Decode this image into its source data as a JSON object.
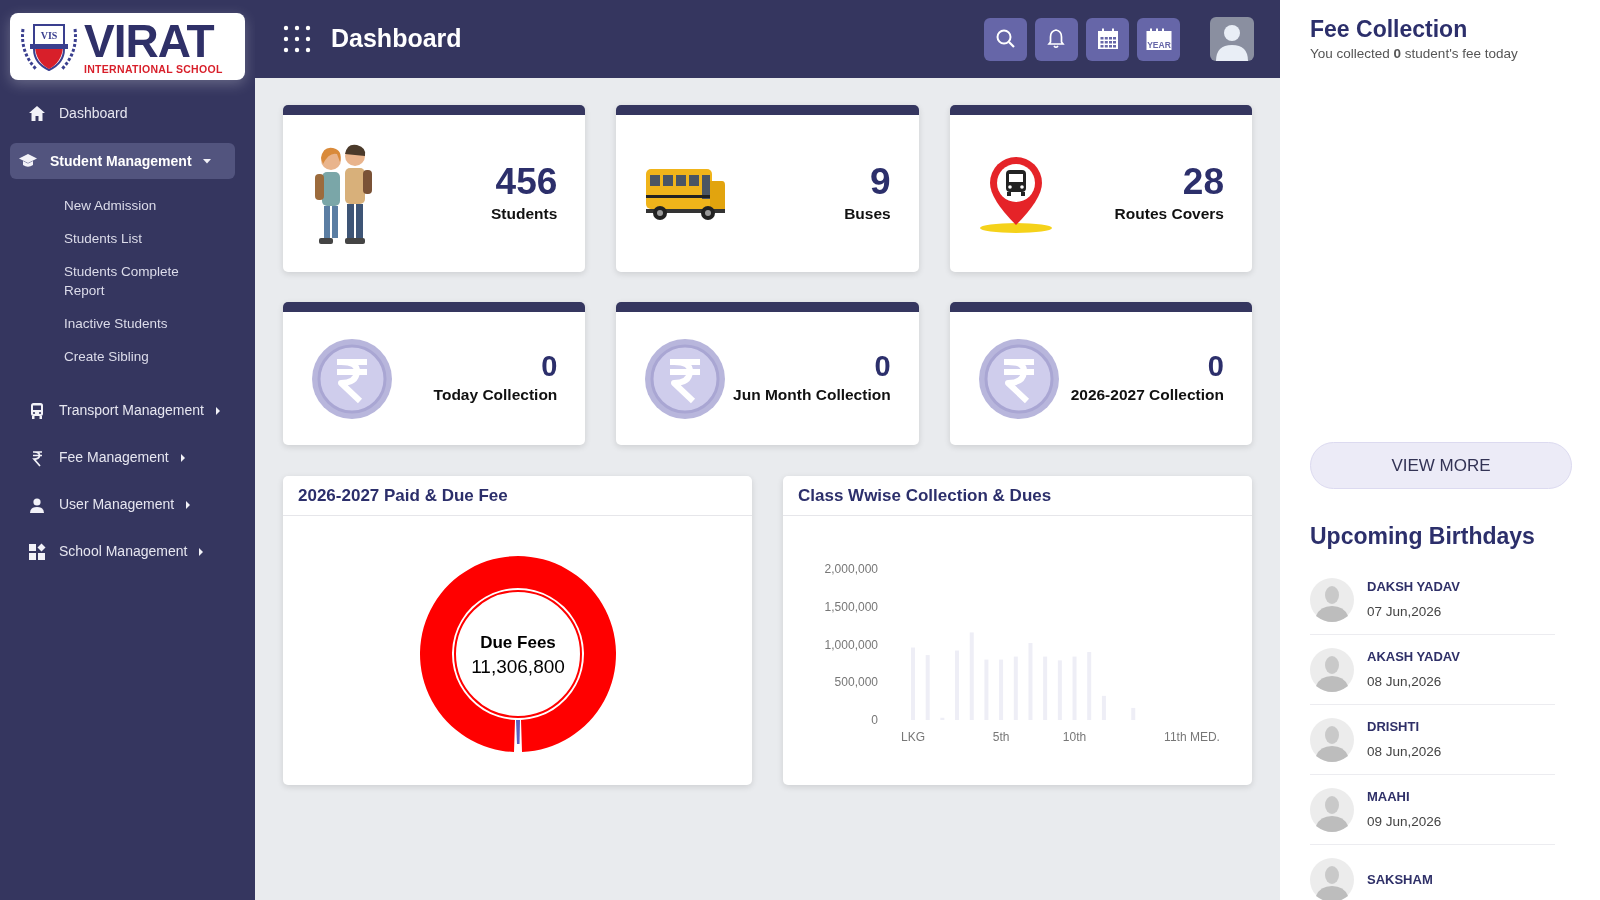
{
  "logo": {
    "badge": "VIS",
    "title": "VIRAT",
    "subtitle": "INTERNATIONAL SCHOOL"
  },
  "sidebar": {
    "items": [
      {
        "label": "Dashboard",
        "kind": "link",
        "selected": false
      },
      {
        "label": "Student Management",
        "kind": "group",
        "selected": true,
        "expanded": true,
        "children": [
          {
            "label": "New Admission",
            "selected": false
          },
          {
            "label": "Students List",
            "selected": false
          },
          {
            "label": "Students Complete Report",
            "selected": false
          },
          {
            "label": "Inactive Students",
            "selected": false
          },
          {
            "label": "Create Sibling",
            "selected": false
          }
        ]
      },
      {
        "label": "Transport Management",
        "kind": "group",
        "selected": false,
        "expanded": false
      },
      {
        "label": "Fee Management",
        "kind": "group",
        "selected": false,
        "expanded": false
      },
      {
        "label": "User Management",
        "kind": "group",
        "selected": false,
        "expanded": false
      },
      {
        "label": "School Management",
        "kind": "group",
        "selected": false,
        "expanded": false
      }
    ]
  },
  "header": {
    "title": "Dashboard",
    "year_button_label": "YEAR"
  },
  "stats": [
    {
      "value": "456",
      "label": "Students"
    },
    {
      "value": "9",
      "label": "Buses"
    },
    {
      "value": "28",
      "label": "Routes Covers"
    },
    {
      "value": "0",
      "label": "Today Collection"
    },
    {
      "value": "0",
      "label": "Jun Month Collection"
    },
    {
      "value": "0",
      "label": "2026-2027 Collection"
    }
  ],
  "fee_chart": {
    "title": "2026-2027 Paid & Due Fee",
    "center_label": "Due Fees",
    "center_value": "11,306,800"
  },
  "class_chart": {
    "title": "Class Wwise Collection & Dues",
    "chart_data": {
      "type": "bar",
      "categories": [
        "LKG",
        null,
        null,
        null,
        null,
        null,
        "5th",
        null,
        null,
        null,
        null,
        "10th",
        null,
        null,
        null,
        null,
        null,
        null,
        null,
        "11th MED."
      ],
      "series": [
        {
          "color": "#eeeef6",
          "values": [
            960000,
            860000,
            30000,
            920000,
            1160000,
            800000,
            800000,
            840000,
            1020000,
            840000,
            790000,
            840000,
            900000,
            320000,
            0,
            160000,
            0,
            0,
            0,
            0
          ]
        }
      ],
      "ylim": [
        0,
        2000000
      ],
      "yticks": [
        {
          "value": 0,
          "label": "0"
        },
        {
          "value": 500000,
          "label": "500,000"
        },
        {
          "value": 1000000,
          "label": "1,000,000"
        },
        {
          "value": 1500000,
          "label": "1,500,000"
        },
        {
          "value": 2000000,
          "label": "2,000,000"
        }
      ]
    }
  },
  "fee_collection": {
    "title": "Fee Collection",
    "message": "You collected **0** student's fee today",
    "button": "VIEW MORE"
  },
  "birthdays": {
    "title": "Upcoming Birthdays",
    "items": [
      {
        "name": "DAKSH YADAV",
        "date": "07 Jun,2026"
      },
      {
        "name": "AKASH YADAV",
        "date": "08 Jun,2026"
      },
      {
        "name": "DRISHTI",
        "date": "08 Jun,2026"
      },
      {
        "name": "MAAHI",
        "date": "09 Jun,2026"
      },
      {
        "name": "SAKSHAM"
      }
    ]
  }
}
